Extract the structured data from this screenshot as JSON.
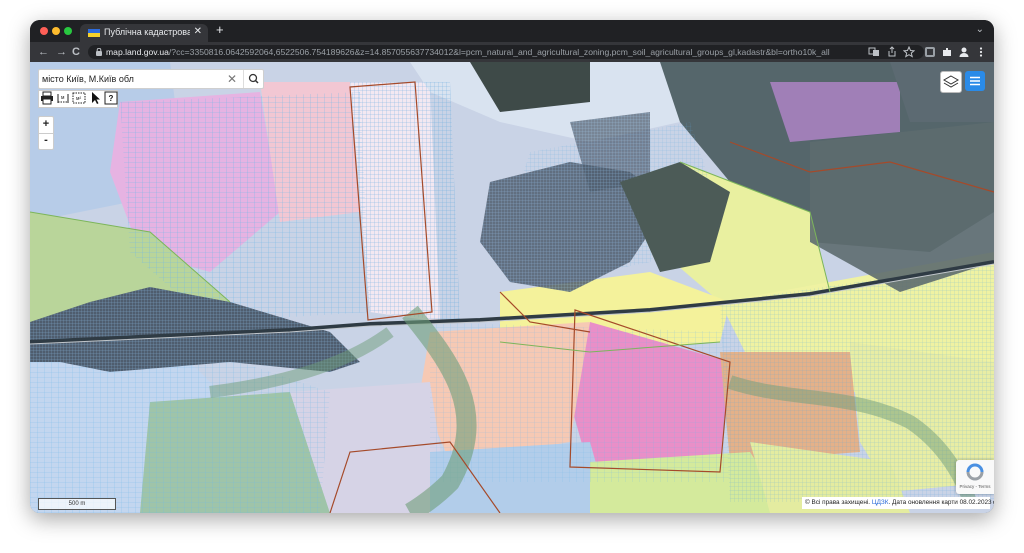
{
  "browser": {
    "tab_title": "Публічна кадастрова карта Україн",
    "tab_close": "✕",
    "new_tab": "+",
    "tab_menu": "⌄",
    "url_host": "map.land.gov.ua",
    "url_path": "/?cc=3350816.0642592064,6522506.754189626&z=14.857055637734012&l=pcm_natural_and_agricultural_zoning,pcm_soil_agricultural_groups_gl,kadastr&bl=ortho10k_all",
    "back": "←",
    "forward": "→",
    "reload": "C",
    "toolbar_icons": [
      "translate-icon",
      "share-icon",
      "bookmark-star-icon",
      "extension-icon",
      "puzzle-icon",
      "profile-icon",
      "kebab-menu-icon"
    ]
  },
  "map": {
    "search": {
      "value": "місто Київ, М.Київ обл",
      "clear": "✕",
      "button_icon": "search-icon"
    },
    "tools": [
      "print-icon",
      "measure-distance-icon",
      "measure-area-icon",
      "pointer-icon",
      "help-icon"
    ],
    "zoom_in": "+",
    "zoom_out": "-",
    "scale": "500 m",
    "recaptcha": "Privacy - Terms",
    "attribution": {
      "prefix": "© Всі права захищені.",
      "link": "ЦДЗК",
      "suffix": ". Дата оновлення карти 08.02.2023",
      "toggle": "▸"
    }
  }
}
